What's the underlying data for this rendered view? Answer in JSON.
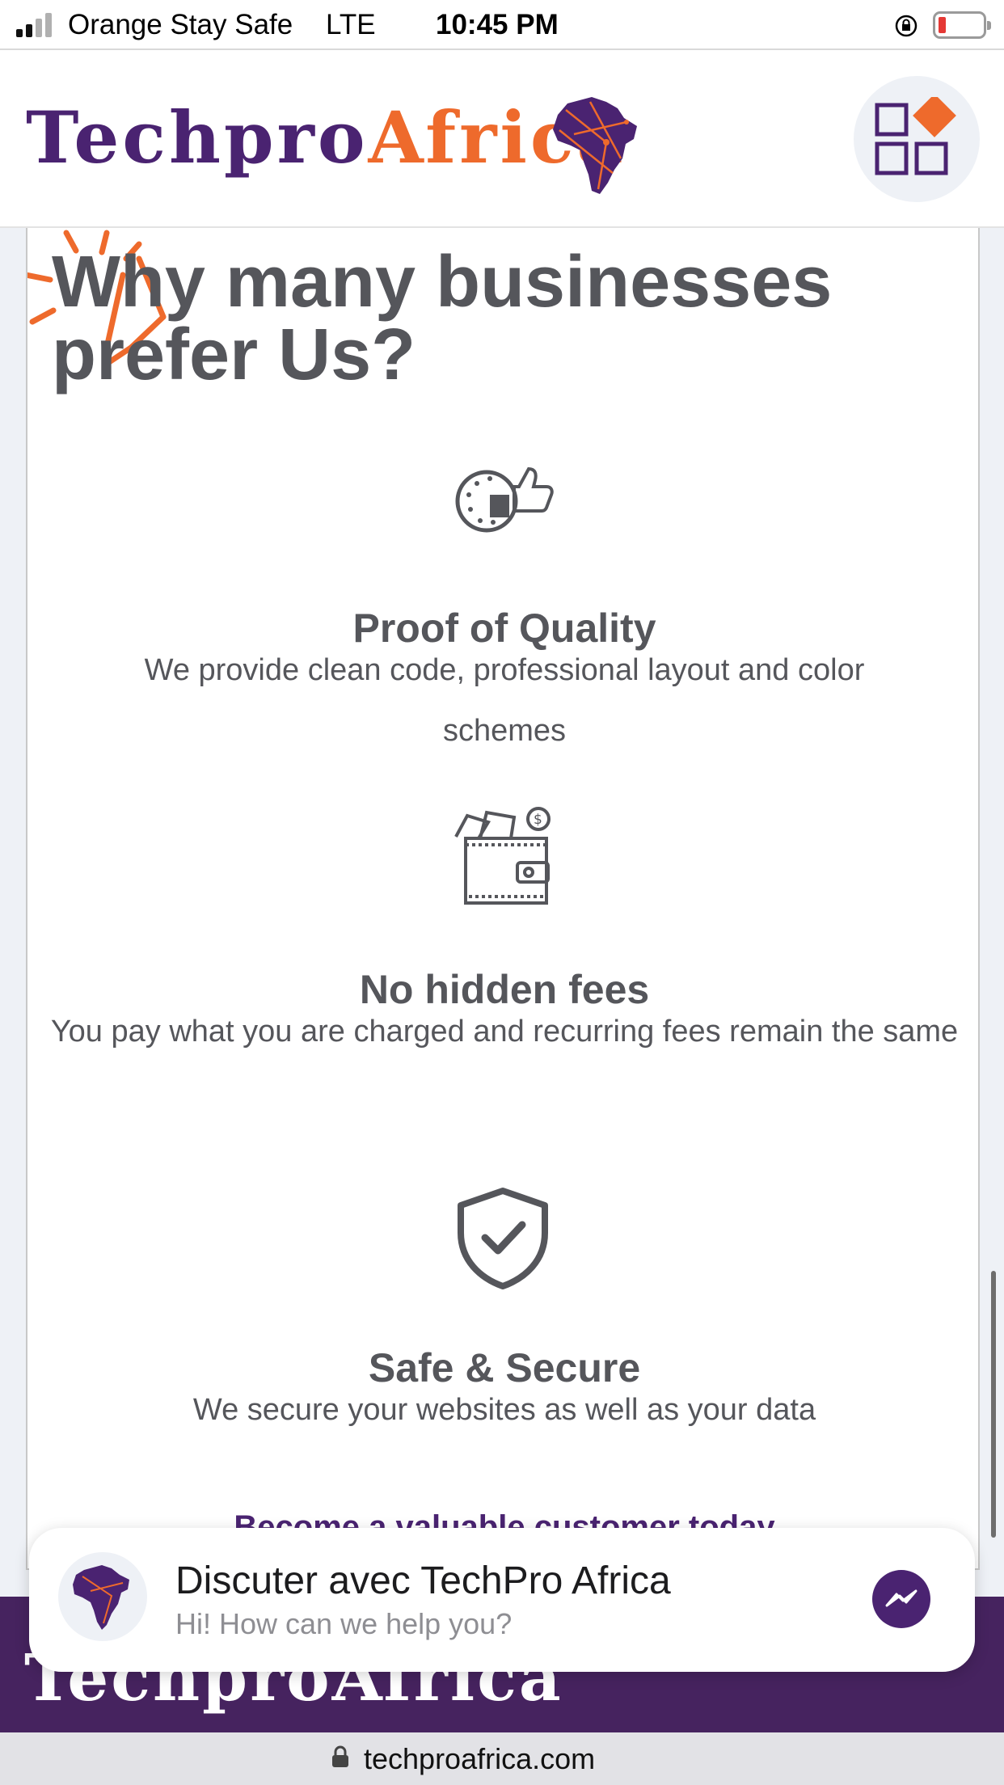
{
  "status_bar": {
    "carrier": "Orange Stay Safe",
    "network": "LTE",
    "time": "10:45 PM",
    "battery_level": 0.12
  },
  "header": {
    "logo_part1": "Techpro",
    "logo_part2": "Africa",
    "menu_icon": "grid-menu-icon"
  },
  "section": {
    "heading": "Why many businesses prefer Us?",
    "features": [
      {
        "icon": "quality-thumbs-up-icon",
        "title": "Proof of Quality",
        "text": "We provide clean code, professional layout and color schemes"
      },
      {
        "icon": "wallet-money-icon",
        "title": "No hidden fees",
        "text": "You pay what you are charged and recurring fees remain the same"
      },
      {
        "icon": "shield-check-icon",
        "title": "Safe & Secure",
        "text": "We secure your websites as well as your data"
      }
    ],
    "cta": "Become a valuable customer today"
  },
  "footer": {
    "logo": "TechproAfrica"
  },
  "chat_widget": {
    "title": "Discuter avec TechPro Africa",
    "subtitle": "Hi! How can we help you?"
  },
  "url_bar": {
    "url": "techproafrica.com"
  },
  "colors": {
    "brand_purple": "#4a2371",
    "brand_orange": "#ee6a2c",
    "text_gray": "#55565b"
  }
}
